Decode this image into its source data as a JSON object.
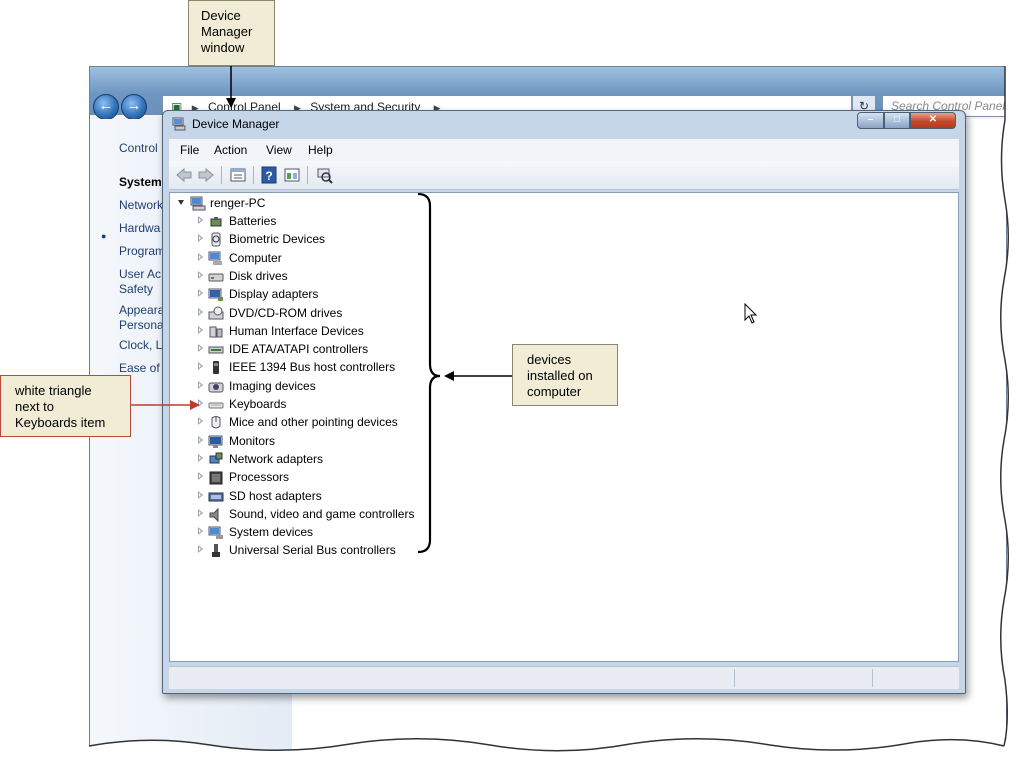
{
  "control_panel": {
    "back_icon": "back-arrow-icon",
    "forward_icon": "forward-arrow-icon",
    "breadcrumbs": [
      "Control Panel",
      "System and Security"
    ],
    "search_placeholder": "Search Control Panel",
    "sidebar_links": [
      "Control",
      "System",
      "Network",
      "Hardwa",
      "Program",
      "User Ac",
      "Safety",
      "Appeara",
      "Persona",
      "Clock, L",
      "Ease of A"
    ]
  },
  "device_manager": {
    "title": "Device Manager",
    "menu": [
      "File",
      "Action",
      "View",
      "Help"
    ],
    "toolbar_icons": [
      "back-icon",
      "forward-icon",
      "properties-icon",
      "help-icon",
      "view-icon",
      "scan-hardware-icon"
    ],
    "window_buttons": {
      "minimize": "–",
      "maximize": "□",
      "close": "✕"
    },
    "computer_name": "renger-PC",
    "device_categories": [
      {
        "label": "Batteries",
        "icon": "battery-icon"
      },
      {
        "label": "Biometric Devices",
        "icon": "biometric-icon"
      },
      {
        "label": "Computer",
        "icon": "computer-icon"
      },
      {
        "label": "Disk drives",
        "icon": "disk-drive-icon"
      },
      {
        "label": "Display adapters",
        "icon": "display-adapter-icon"
      },
      {
        "label": "DVD/CD-ROM drives",
        "icon": "dvd-drive-icon"
      },
      {
        "label": "Human Interface Devices",
        "icon": "hid-icon"
      },
      {
        "label": "IDE ATA/ATAPI controllers",
        "icon": "ide-controller-icon"
      },
      {
        "label": "IEEE 1394 Bus host controllers",
        "icon": "ieee1394-icon"
      },
      {
        "label": "Imaging devices",
        "icon": "imaging-device-icon"
      },
      {
        "label": "Keyboards",
        "icon": "keyboard-icon"
      },
      {
        "label": "Mice and other pointing devices",
        "icon": "mouse-icon"
      },
      {
        "label": "Monitors",
        "icon": "monitor-icon"
      },
      {
        "label": "Network adapters",
        "icon": "network-adapter-icon"
      },
      {
        "label": "Processors",
        "icon": "processor-icon"
      },
      {
        "label": "SD host adapters",
        "icon": "sd-adapter-icon"
      },
      {
        "label": "Sound, video and game controllers",
        "icon": "sound-icon"
      },
      {
        "label": "System devices",
        "icon": "system-device-icon"
      },
      {
        "label": "Universal Serial Bus controllers",
        "icon": "usb-icon"
      }
    ]
  },
  "callouts": {
    "device_manager_window": [
      "Device",
      "Manager",
      "window"
    ],
    "devices_installed": [
      "devices",
      "installed on",
      "computer"
    ],
    "white_triangle": [
      "white triangle",
      "next to",
      "Keyboards item"
    ]
  },
  "colors": {
    "callout_fill": "#f1ecd6",
    "callout_arrow_red": "#c0392b",
    "title_gradient": "#6f97c2"
  }
}
